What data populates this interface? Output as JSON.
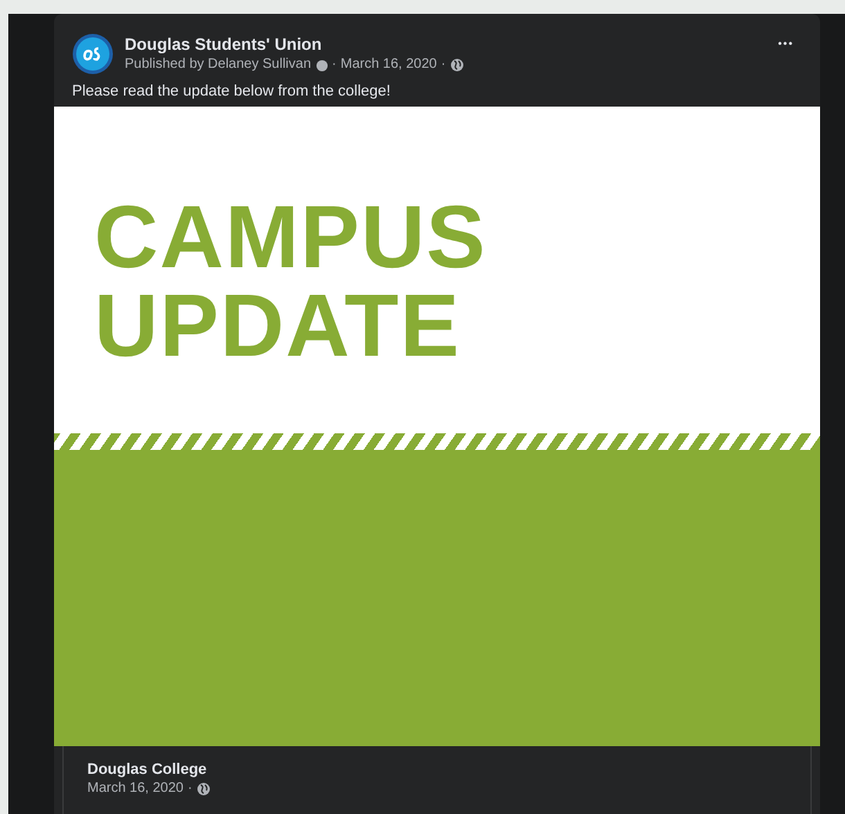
{
  "post": {
    "page_name": "Douglas Students' Union",
    "published_by": "Published by Delaney Sullivan",
    "date": "March 16, 2020",
    "separator": "·",
    "message": "Please read the update below from the college!",
    "image": {
      "headline": [
        "CAMPUS",
        "UPDATE"
      ]
    },
    "more_button": "•••"
  },
  "shared_post": {
    "page_name": "Douglas College",
    "date": "March 16, 2020",
    "separator": "·"
  }
}
